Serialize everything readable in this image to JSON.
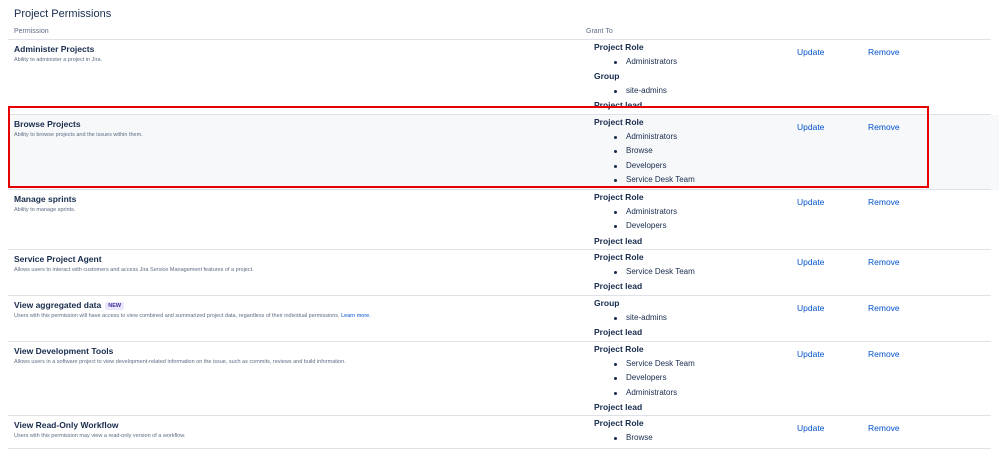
{
  "section_title": "Project Permissions",
  "columns": {
    "permission": "Permission",
    "grant_to": "Grant To"
  },
  "actions": {
    "update": "Update",
    "remove": "Remove"
  },
  "rows": [
    {
      "name": "Administer Projects",
      "description": "Ability to administer a project in Jira.",
      "grants": [
        {
          "type": "Project Role",
          "items": [
            "Administrators"
          ]
        },
        {
          "type": "Group",
          "items": [
            "site-admins"
          ]
        },
        {
          "type": "Project lead",
          "items": []
        }
      ]
    },
    {
      "name": "Browse Projects",
      "description": "Ability to browse projects and the issues within them.",
      "highlighted": true,
      "grants": [
        {
          "type": "Project Role",
          "items": [
            "Administrators",
            "Browse",
            "Developers",
            "Service Desk Team"
          ]
        }
      ]
    },
    {
      "name": "Manage sprints",
      "description": "Ability to manage sprints.",
      "grants": [
        {
          "type": "Project Role",
          "items": [
            "Administrators",
            "Developers"
          ]
        },
        {
          "type": "Project lead",
          "items": []
        }
      ]
    },
    {
      "name": "Service Project Agent",
      "description": "Allows users to interact with customers and access Jira Service Management features of a project.",
      "grants": [
        {
          "type": "Project Role",
          "items": [
            "Service Desk Team"
          ]
        },
        {
          "type": "Project lead",
          "items": []
        }
      ]
    },
    {
      "name": "View aggregated data",
      "badge": "NEW",
      "description": "Users with this permission will have access to view combined and summarized project data, regardless of their individual permissions.",
      "link": "Learn more.",
      "grants": [
        {
          "type": "Group",
          "items": [
            "site-admins"
          ]
        },
        {
          "type": "Project lead",
          "items": []
        }
      ]
    },
    {
      "name": "View Development Tools",
      "description": "Allows users in a software project to view development-related information on the issue, such as commits, reviews and build information.",
      "grants": [
        {
          "type": "Project Role",
          "items": [
            "Service Desk Team",
            "Developers",
            "Administrators"
          ]
        },
        {
          "type": "Project lead",
          "items": []
        }
      ]
    },
    {
      "name": "View Read-Only Workflow",
      "description": "Users with this permission may view a read-only version of a workflow.",
      "grants": [
        {
          "type": "Project Role",
          "items": [
            "Browse"
          ]
        }
      ]
    }
  ]
}
